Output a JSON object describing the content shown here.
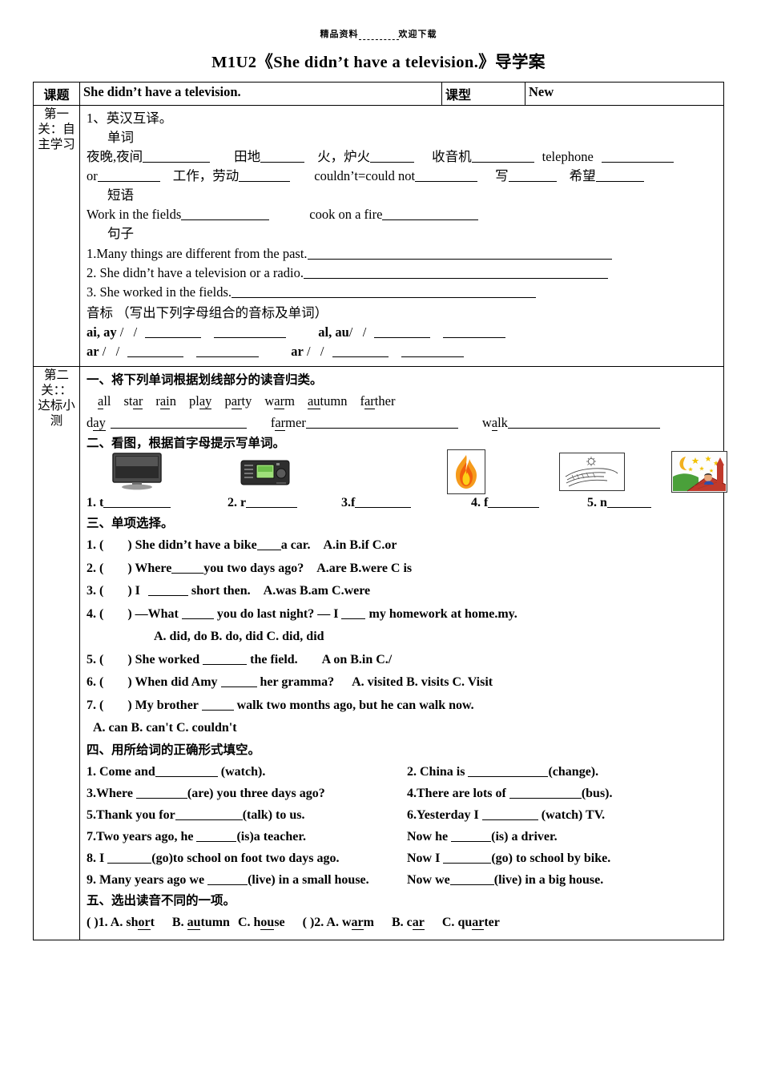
{
  "watermark": {
    "left": "精品资料",
    "right": "欢迎下载"
  },
  "doc_title": "M1U2《She didn’t have a television.》导学案",
  "header_row": {
    "label_topic": "课题",
    "value_topic": "She didn’t have a television.",
    "label_type": "课型",
    "value_type": "New"
  },
  "section1": {
    "vertical_label": "第一关：自主学习",
    "heading": "1、英汉互译。",
    "sub_words": "单词",
    "words_line1": [
      {
        "text": "夜晚,夜间",
        "blank": 84
      },
      {
        "text": "田地",
        "blank": 55
      },
      {
        "text": "火，炉火",
        "blank": 55
      },
      {
        "text": "收音机",
        "blank": 78
      },
      {
        "text": "telephone",
        "blank": 90
      }
    ],
    "words_line2": [
      {
        "text": "or",
        "blank": 78
      },
      {
        "text": "工作，劳动",
        "blank": 64
      },
      {
        "text": "couldn’t=could not",
        "blank": 78
      },
      {
        "text": "写",
        "blank": 60
      },
      {
        "text": "希望",
        "blank": 60
      }
    ],
    "sub_phrases": "短语",
    "phrases": [
      {
        "text": "Work in the fields",
        "blank": 110
      },
      {
        "text": "cook on a fire",
        "blank": 120
      }
    ],
    "sub_sentences": "句子",
    "sentences": [
      {
        "text": "1.Many things are different from the past.",
        "blank": 380
      },
      {
        "text": "2. She didn’t have a television or a radio.",
        "blank": 380
      },
      {
        "text": "3. She worked in the fields.",
        "blank": 380
      }
    ],
    "phonetics_heading": "音标 （写出下列字母组合的音标及单词）",
    "phonetics_rows": [
      {
        "pair1": "ai, ay",
        "pair2": "al, au"
      },
      {
        "pair1": "ar",
        "pair2": "ar"
      }
    ]
  },
  "section2": {
    "vertical_label": "第二关：：达标小测",
    "ex1": {
      "heading": "一、将下列单词根据划线部分的读音归类。",
      "words": [
        {
          "pre": "",
          "mid": "a",
          "post": "ll"
        },
        {
          "pre": "st",
          "mid": "ar",
          "post": ""
        },
        {
          "pre": "r",
          "mid": "ai",
          "post": "n"
        },
        {
          "pre": "pl",
          "mid": "ay",
          "post": ""
        },
        {
          "pre": "p",
          "mid": "ar",
          "post": "ty"
        },
        {
          "pre": "w",
          "mid": "ar",
          "post": "m"
        },
        {
          "pre": "",
          "mid": "au",
          "post": "tumn"
        },
        {
          "pre": "f",
          "mid": "ar",
          "post": "ther"
        }
      ],
      "categories": [
        {
          "pre": "d",
          "mid": "ay",
          "post": "",
          "blank": 170
        },
        {
          "pre": "f",
          "mid": "ar",
          "post": "mer",
          "blank": 190
        },
        {
          "pre": "w",
          "mid": "a",
          "post": "lk",
          "blank": 190
        }
      ]
    },
    "ex2": {
      "heading": "二、看图，根据首字母提示写单词。",
      "items": [
        {
          "num": "1.",
          "letter": "t",
          "blank": 84,
          "icon": "television-icon"
        },
        {
          "num": "2.",
          "letter": "r",
          "blank": 64,
          "icon": "radio-icon"
        },
        {
          "num": "3.",
          "letter": "f",
          "blank": 70,
          "icon": "fire-icon"
        },
        {
          "num": "4.",
          "letter": "f",
          "blank": 64,
          "icon": "fields-icon"
        },
        {
          "num": "5.",
          "letter": "n",
          "blank": 55,
          "icon": "night-icon"
        }
      ]
    },
    "ex3": {
      "heading": "三、单项选择。",
      "items": [
        {
          "num": "1. (",
          "close": ")",
          "stem": "She didn’t have a bike",
          "blank": 30,
          "stem2": "a car.",
          "options": "A.in   B.if     C.or"
        },
        {
          "num": "2. (",
          "close": ")",
          "stem": "Where",
          "blank": 40,
          "stem2": "you two days ago?",
          "options": "A.are   B.were     C is"
        },
        {
          "num": "3. (",
          "close": ")",
          "stem": "I",
          "blank": 50,
          "stem2": "short then.",
          "options": "A.was     B.am     C.were"
        },
        {
          "num": "4. (",
          "close": ")",
          "stem": "—What",
          "blank": 40,
          "stem2": "you do last night?    — I",
          "blank2": 30,
          "stem3": "my homework at home.my.",
          "options": ""
        }
      ],
      "item4_options": "A. did, do           B. do, did        C. did, did",
      "items_cont": [
        {
          "num": "5. (",
          "close": ")",
          "stem": "She worked",
          "blank": 55,
          "stem2": "the field.",
          "options": "A on     B.in    C./"
        },
        {
          "num": "6. (",
          "close": ")",
          "stem": "When did Amy",
          "blank": 45,
          "stem2": "her gramma?",
          "options": "A. visited   B. visits        C. Visit"
        },
        {
          "num": "7. (",
          "close": ")",
          "stem": "My brother",
          "blank": 40,
          "stem2": "walk two months ago, but he can walk now.",
          "options": ""
        }
      ],
      "item7_options": "A. can   B. can't   C. couldn't"
    },
    "ex4": {
      "heading": "四、用所给词的正确形式填空。",
      "rows": [
        {
          "left": "1. Come and",
          "lblank": 78,
          "lend": "(watch).",
          "right": "2. China is",
          "rblank": 100,
          "rend": "(change)."
        },
        {
          "left": "3.Where",
          "lblank": 64,
          "lend": "(are) you three days ago?",
          "right": "4.There are lots of",
          "rblank": 90,
          "rend": "(bus)."
        },
        {
          "left": "5.Thank you for",
          "lblank": 84,
          "lend": "(talk) to us.",
          "right": "6.Yesterday I",
          "rblank": 70,
          "rend": "(watch) TV."
        },
        {
          "left": "7.Two years ago, he",
          "lblank": 50,
          "lend": "(is)a teacher.",
          "right": "Now he",
          "rblank": 50,
          "rend": "(is) a driver."
        },
        {
          "left": "8. I",
          "lblank": 55,
          "lend": "(go)to school on foot two days ago.",
          "right": "Now I",
          "rblank": 60,
          "rend": "(go) to school by bike."
        },
        {
          "left": "9. Many years ago we",
          "lblank": 50,
          "lend": "(live) in a small house.",
          "right": "Now we",
          "rblank": 55,
          "rend": "(live) in a big house."
        }
      ]
    },
    "ex5": {
      "heading": "五、选出读音不同的一项。",
      "q1": {
        "prefix": "(      )1.",
        "a": {
          "label": "A. ",
          "pre": "sh",
          "mid": "or",
          "post": "t"
        },
        "b": {
          "label": "B. ",
          "pre": "",
          "mid": "au",
          "post": "tumn"
        },
        "c": {
          "label": "C. ",
          "pre": "h",
          "mid": "ou",
          "post": "se"
        }
      },
      "q2": {
        "prefix": "(      )2.",
        "a": {
          "label": "A. ",
          "pre": "w",
          "mid": "ar",
          "post": "m"
        },
        "b": {
          "label": "B. ",
          "pre": "c",
          "mid": "ar",
          "post": ""
        },
        "c": {
          "label": "C. ",
          "pre": "qu",
          "mid": "ar",
          "post": "ter"
        }
      }
    }
  }
}
